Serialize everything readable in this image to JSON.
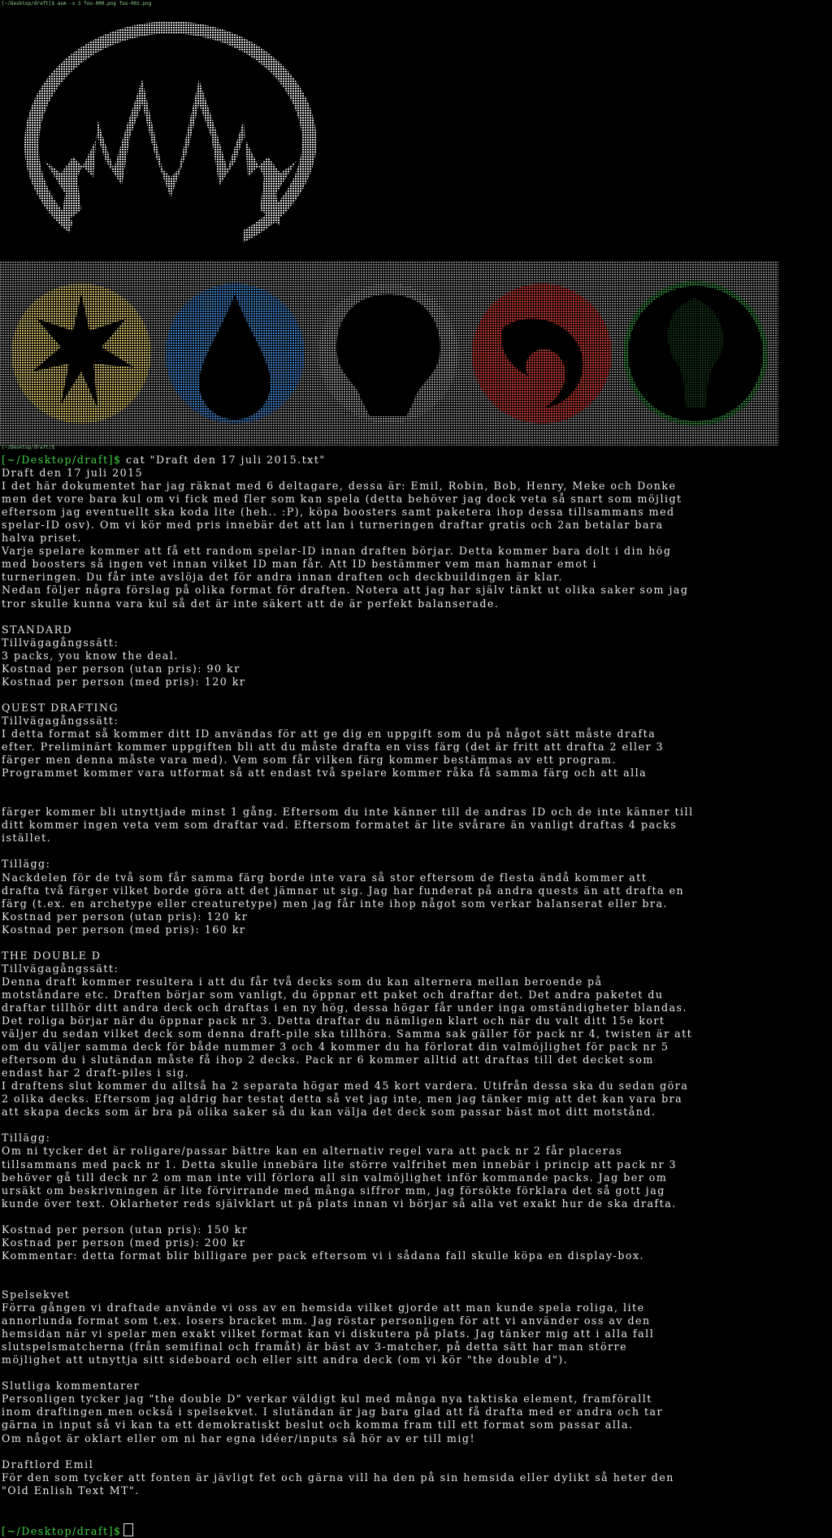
{
  "terminal": {
    "top_command": "[~/Desktop/draft]$ asm -s 3 foo-000.png foo-002.png",
    "small_prompt": "[~/Desktop/draft]$",
    "prompt": "[~/Desktop/draft]$",
    "command": " cat \"Draft den 17 juli 2015.txt\"",
    "final_prompt": "[~/Desktop/draft]$",
    "lines": [
      "Draft den 17 juli 2015",
      "I det här dokumentet har jag räknat med 6 deltagare, dessa är: Emil, Robin, Bob, Henry, Meke och Donke",
      "men det vore bara kul om vi fick med fler som kan spela (detta behöver jag dock veta så snart som möjligt",
      "eftersom jag eventuellt ska koda lite (heh.. :P), köpa boosters samt paketera ihop dessa tillsammans med",
      "spelar-ID osv). Om vi kör med pris innebär det att lan i turneringen draftar gratis och 2an betalar bara",
      "halva priset.",
      "Varje spelare kommer att få ett random spelar-ID innan draften börjar. Detta kommer bara dolt i din hög",
      "med boosters så ingen vet innan vilket ID man får. Att ID bestämmer vem man hamnar emot i",
      "turneringen. Du får inte avslöja det för andra innan draften och deckbuildingen är klar.",
      "Nedan följer några förslag på olika format för draften. Notera att jag har själv tänkt ut olika saker som jag",
      "tror skulle kunna vara kul så det är inte säkert att de är perfekt balanserade.",
      "",
      "STANDARD",
      "Tillvägagångssätt:",
      "3 packs, you know the deal.",
      "Kostnad per person (utan pris): 90 kr",
      "Kostnad per person (med pris): 120 kr",
      "",
      "QUEST DRAFTING",
      "Tillvägagångssätt:",
      "I detta format så kommer ditt ID användas för att ge dig en uppgift som du på något sätt måste drafta",
      "efter. Preliminärt kommer uppgiften bli att du måste drafta en viss färg (det är fritt att drafta 2 eller 3",
      "färger men denna måste vara med). Vem som får vilken färg kommer bestämmas av ett program.",
      "Programmet kommer vara utformat så att endast två spelare kommer råka få samma färg och att alla",
      "",
      "",
      "färger kommer bli utnyttjade minst 1 gång. Eftersom du inte känner till de andras ID och de inte känner till",
      "ditt kommer ingen veta vem som draftar vad. Eftersom formatet är lite svårare än vanligt draftas 4 packs",
      "istället.",
      "",
      "Tillägg:",
      "Nackdelen för de två som får samma färg borde inte vara så stor eftersom de flesta ändå kommer att",
      "drafta två färger vilket borde göra att det jämnar ut sig. Jag har funderat på andra quests än att drafta en",
      "färg (t.ex. en archetype eller creaturetype) men jag får inte ihop något som verkar balanserat eller bra.",
      "Kostnad per person (utan pris): 120 kr",
      "Kostnad per person (med pris): 160 kr",
      "",
      "THE DOUBLE D",
      "Tillvägagångssätt:",
      "Denna draft kommer resultera i att du får två decks som du kan alternera mellan beroende på",
      "motståndare etc. Draften börjar som vanligt, du öppnar ett paket och draftar det. Det andra paketet du",
      "draftar tillhör ditt andra deck och draftas i en ny hög, dessa högar får under inga omständigheter blandas.",
      "Det roliga börjar när du öppnar pack nr 3. Detta draftar du nämligen klart och när du valt ditt 15e kort",
      "väljer du sedan vilket deck som denna draft-pile ska tillhöra. Samma sak gäller för pack nr 4, twisten är att",
      "om du väljer samma deck för både nummer 3 och 4 kommer du ha förlorat din valmöjlighet för pack nr 5",
      "eftersom du i slutändan måste få ihop 2 decks. Pack nr 6 kommer alltid att draftas till det decket som",
      "endast har 2 draft-piles i sig.",
      "I draftens slut kommer du alltså ha 2 separata högar med 45 kort vardera. Utifrån dessa ska du sedan göra",
      "2 olika decks. Eftersom jag aldrig har testat detta så vet jag inte, men jag tänker mig att det kan vara bra",
      "att skapa decks som är bra på olika saker så du kan välja det deck som passar bäst mot ditt motstånd.",
      "",
      "Tillägg:",
      "Om ni tycker det är roligare/passar bättre kan en alternativ regel vara att pack nr 2 får placeras",
      "tillsammans med pack nr 1. Detta skulle innebära lite större valfrihet men innebär i princip att pack nr 3",
      "behöver gå till deck nr 2 om man inte vill förlora all sin valmöjlighet inför kommande packs. Jag ber om",
      "ursäkt om beskrivningen är lite förvirrande med många siffror mm, jag försökte förklara det så gott jag",
      "kunde över text. Oklarheter reds självklart ut på plats innan vi börjar så alla vet exakt hur de ska drafta.",
      "",
      "Kostnad per person (utan pris): 150 kr",
      "Kostnad per person (med pris): 200 kr",
      "Kommentar: detta format blir billigare per pack eftersom vi i sådana fall skulle köpa en display-box.",
      "",
      "",
      "Spelsekvet",
      "Förra gången vi draftade använde vi oss av en hemsida vilket gjorde att man kunde spela roliga, lite",
      "annorlunda format som t.ex. losers bracket mm. Jag röstar personligen för att vi använder oss av den",
      "hemsidan när vi spelar men exakt vilket format kan vi diskutera på plats. Jag tänker mig att i alla fall",
      "slutspelsmatcherna (från semifinal och framåt) är bäst av 3-matcher, på detta sätt har man större",
      "möjlighet att utnyttja sitt sideboard och eller sitt andra deck (om vi kör \"the double d\").",
      "",
      "Slutliga kommentarer",
      "Personligen tycker jag \"the double D\" verkar väldigt kul med många nya taktiska element, framförallt",
      "inom draftingen men också i spelsekvet. I slutändan är jag bara glad att få drafta med er andra och tar",
      "gärna in input så vi kan ta ett demokratiskt beslut och komma fram till ett format som passar alla.",
      "Om något är oklart eller om ni har egna idéer/inputs så hör av er till mig!",
      "",
      "Draftlord Emil",
      "För den som tycker att fonten är jävligt fet och gärna vill ha den på sin hemsida eller dylikt så heter den",
      "\"Old Enlish Text MT\".",
      "",
      ""
    ]
  },
  "colors": {
    "background": "#000000",
    "text": "#e8e8e8",
    "prompt": "#44d244",
    "white_mana": "#c9b866",
    "blue_mana": "#3d7ec2",
    "black_mana": "#8a8a8a",
    "red_mana": "#c23a30",
    "green_mana": "#2f8a3a"
  },
  "icons": [
    "planeswalker-logo-icon",
    "white-mana-icon",
    "blue-mana-icon",
    "black-mana-icon",
    "red-mana-icon",
    "green-mana-icon",
    "cursor-icon"
  ]
}
